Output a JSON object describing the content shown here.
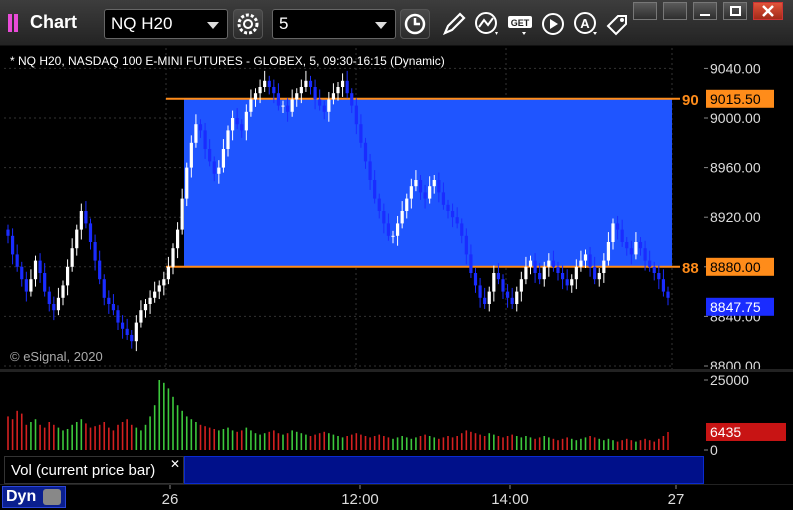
{
  "app": {
    "title": "Chart"
  },
  "toolbar": {
    "symbol": "NQ H20",
    "interval": "5"
  },
  "chart": {
    "title": "* NQ H20, NASDAQ 100 E-MINI FUTURES - GLOBEX, 5, 09:30-16:15 (Dynamic)",
    "copyright": "© eSignal, 2020",
    "price_ticks": [
      "9040.00",
      "9000.00",
      "8960.00",
      "8920.00",
      "8880.00",
      "8840.00",
      "8800.00"
    ],
    "upper_line_label": "90",
    "upper_line_price": "9015.50",
    "lower_line_label": "88",
    "lower_line_price": "8880.00",
    "last_price": "8847.75",
    "colors": {
      "up": "#ffffff",
      "down": "#1a2cff",
      "zone": "#1f55ff",
      "line": "#ff8c1a",
      "label": "#ff8c1a"
    }
  },
  "volume": {
    "ticks": [
      "25000",
      "0"
    ],
    "current_value": "6435",
    "study_label": "Vol (current price bar)",
    "colors": {
      "up": "#3cc83c",
      "down": "#d42020",
      "current": "#c81414"
    }
  },
  "time_axis": {
    "labels": [
      "26",
      "12:00",
      "14:00",
      "27"
    ]
  },
  "footer": {
    "dyn_label": "Dyn"
  },
  "chart_data": {
    "type": "candlestick",
    "title": "* NQ H20, NASDAQ 100 E-MINI FUTURES - GLOBEX, 5, 09:30-16:15 (Dynamic)",
    "ylim": [
      8800,
      9050
    ],
    "levels": [
      9015.5,
      8880.0
    ],
    "last_price": 8847.75,
    "volume_ylim": [
      0,
      25000
    ],
    "x_labels": [
      "26",
      "12:00",
      "14:00",
      "27"
    ],
    "closes": [
      8905,
      8890,
      8880,
      8870,
      8860,
      8870,
      8885,
      8875,
      8860,
      8850,
      8845,
      8855,
      8865,
      8880,
      8895,
      8910,
      8925,
      8915,
      8900,
      8885,
      8870,
      8855,
      8850,
      8845,
      8835,
      8830,
      8825,
      8820,
      8835,
      8845,
      8850,
      8855,
      8860,
      8865,
      8870,
      8880,
      8895,
      8910,
      8935,
      8960,
      8980,
      8995,
      8990,
      8975,
      8965,
      8955,
      8960,
      8975,
      8990,
      9000,
      8995,
      8990,
      9005,
      9015,
      9020,
      9025,
      9030,
      9025,
      9020,
      9010,
      9010,
      9005,
      9015,
      9020,
      9025,
      9030,
      9025,
      9015,
      9010,
      9005,
      9015,
      9020,
      9025,
      9030,
      9020,
      9010,
      8995,
      8980,
      8965,
      8950,
      8935,
      8925,
      8915,
      8905,
      8905,
      8915,
      8925,
      8935,
      8945,
      8950,
      8940,
      8935,
      8945,
      8950,
      8940,
      8930,
      8925,
      8920,
      8915,
      8905,
      8890,
      8875,
      8865,
      8855,
      8850,
      8860,
      8875,
      8870,
      8860,
      8855,
      8850,
      8860,
      8870,
      8880,
      8885,
      8875,
      8870,
      8880,
      8885,
      8880,
      8875,
      8870,
      8865,
      8870,
      8880,
      8885,
      8890,
      8880,
      8870,
      8875,
      8885,
      8900,
      8915,
      8910,
      8900,
      8895,
      8890,
      8900,
      8895,
      8885,
      8880,
      8875,
      8870,
      8860,
      8855
    ],
    "volumes": [
      12000,
      11000,
      14000,
      13000,
      9000,
      10000,
      11000,
      9000,
      8000,
      10000,
      9000,
      8000,
      7000,
      7500,
      9000,
      10000,
      11000,
      9500,
      8000,
      8500,
      9000,
      10000,
      8000,
      7000,
      9000,
      10000,
      11000,
      9000,
      8000,
      7000,
      9000,
      12000,
      16000,
      25000,
      24000,
      22000,
      19000,
      16000,
      14000,
      12000,
      11000,
      10000,
      9000,
      8500,
      8000,
      7500,
      7000,
      7500,
      8000,
      7000,
      6500,
      7000,
      8000,
      7000,
      6000,
      5500,
      6000,
      6500,
      7000,
      6000,
      5500,
      6000,
      7000,
      6500,
      6000,
      5500,
      5000,
      5500,
      6000,
      6500,
      6000,
      5500,
      5000,
      4500,
      5000,
      5500,
      6000,
      5500,
      5000,
      4500,
      5000,
      5500,
      5000,
      4500,
      4000,
      4500,
      5000,
      4500,
      4000,
      4500,
      5000,
      5500,
      5000,
      4500,
      4000,
      4500,
      5000,
      4500,
      5000,
      6000,
      7000,
      6500,
      6000,
      5500,
      5000,
      6000,
      5500,
      5000,
      4500,
      5000,
      5500,
      5000,
      4500,
      5000,
      4500,
      4000,
      4500,
      5000,
      4500,
      4000,
      3500,
      4000,
      4500,
      4000,
      3500,
      4000,
      4500,
      5000,
      4500,
      4000,
      3500,
      4000,
      3500,
      3000,
      3500,
      4000,
      3500,
      3000,
      3500,
      4000,
      3500,
      3000,
      4000,
      5000,
      6435
    ]
  }
}
